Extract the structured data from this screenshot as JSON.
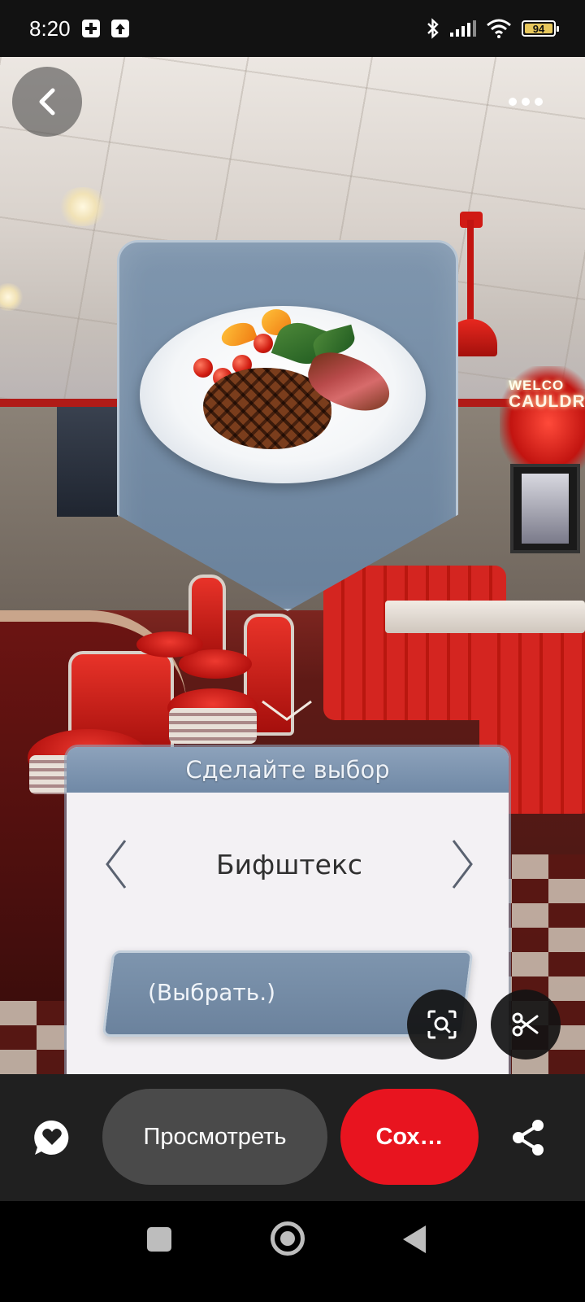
{
  "status_bar": {
    "time": "8:20",
    "battery_level": "94",
    "battery_color": "#e7c75c",
    "icons": [
      "battery-saver-icon",
      "upload-icon",
      "bluetooth-icon",
      "signal-icon",
      "wifi-icon",
      "battery-icon"
    ]
  },
  "scene": {
    "neon_sign_top": "WELCO",
    "neon_sign_main": "CAULDR",
    "dish_icon": "steak-plate-image"
  },
  "top_controls": {
    "back_icon": "chevron-left-icon",
    "more_icon": "more-dots-icon"
  },
  "choice": {
    "title": "Сделайте выбор",
    "value": "Бифштекс",
    "select_label": "(Выбрать.)",
    "prev_icon": "chevron-left-icon",
    "next_icon": "chevron-right-icon"
  },
  "fabs": {
    "visual_search_icon": "visual-search-icon",
    "cut_icon": "scissors-icon"
  },
  "action_bar": {
    "comment_icon": "comment-heart-icon",
    "view_label": "Просмотреть",
    "save_label": "Сох…",
    "share_icon": "share-icon",
    "save_color": "#e8141f"
  },
  "nav_bar": {
    "recents_icon": "recents-square-icon",
    "home_icon": "home-circle-icon",
    "back_icon": "back-triangle-icon"
  }
}
